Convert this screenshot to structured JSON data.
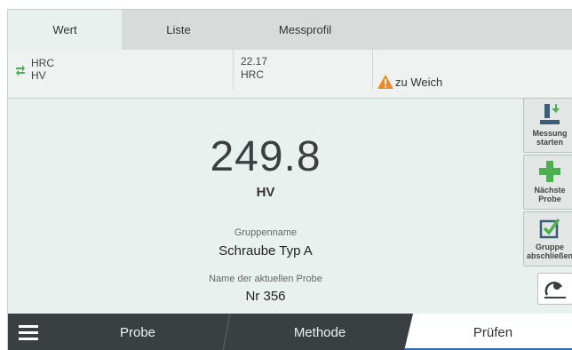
{
  "tabs": [
    {
      "label": "Wert",
      "active": true
    },
    {
      "label": "Liste",
      "active": false
    },
    {
      "label": "Messprofil",
      "active": false
    }
  ],
  "conversion": {
    "from_scale_top": "HRC",
    "from_scale_bottom": "HV",
    "value": "22.17",
    "value_unit": "HRC",
    "warning": "zu Weich"
  },
  "measurement": {
    "value": "249.8",
    "unit": "HV",
    "group_label": "Gruppenname",
    "group_name": "Schraube Typ A",
    "probe_label": "Name der aktuellen Probe",
    "probe_name": "Nr 356"
  },
  "side_buttons": {
    "start_line1": "Messung",
    "start_line2": "starten",
    "next_line1": "Nächste",
    "next_line2": "Probe",
    "close_line1": "Gruppe",
    "close_line2": "abschließen"
  },
  "bottom_nav": [
    {
      "label": "Probe"
    },
    {
      "label": "Methode"
    },
    {
      "label": "Prüfen",
      "active": true
    }
  ],
  "colors": {
    "accent_blue": "#2a6db5",
    "green": "#4caf50",
    "warning_orange": "#f08a24",
    "nav_dark": "#3a3f41"
  }
}
